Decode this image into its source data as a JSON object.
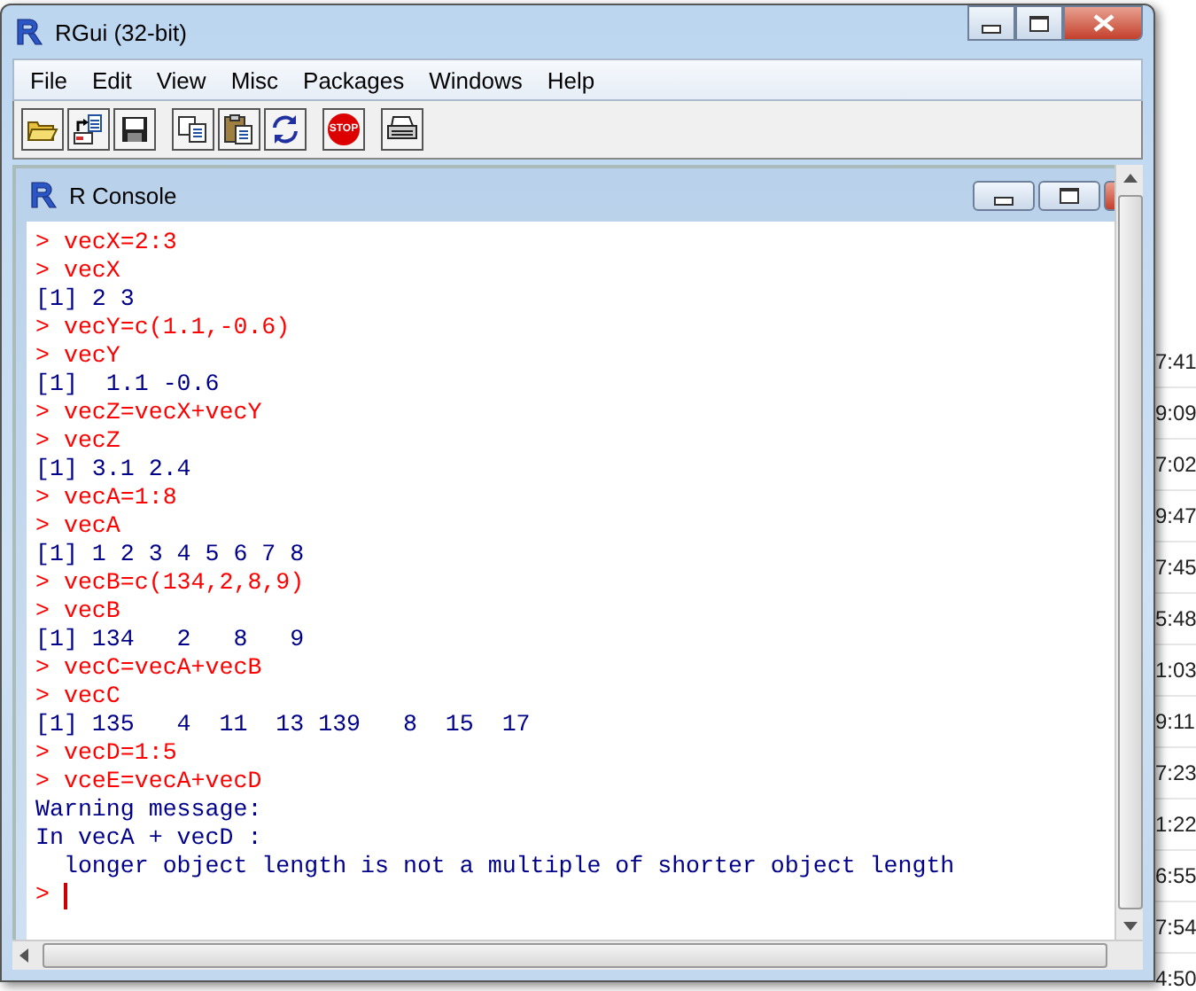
{
  "window": {
    "title": "RGui (32-bit)"
  },
  "menu": [
    "File",
    "Edit",
    "View",
    "Misc",
    "Packages",
    "Windows",
    "Help"
  ],
  "toolbar": [
    {
      "kind": "open"
    },
    {
      "kind": "load"
    },
    {
      "kind": "save"
    },
    {
      "kind": "sep"
    },
    {
      "kind": "copy"
    },
    {
      "kind": "paste"
    },
    {
      "kind": "refresh"
    },
    {
      "kind": "sep"
    },
    {
      "kind": "stop",
      "label": "STOP"
    },
    {
      "kind": "sep"
    },
    {
      "kind": "print"
    }
  ],
  "console": {
    "title": "R Console",
    "lines": [
      {
        "kind": "input",
        "prompt": ">",
        "text": "vecX=2:3"
      },
      {
        "kind": "input",
        "prompt": ">",
        "text": "vecX"
      },
      {
        "kind": "output",
        "text": "[1] 2 3"
      },
      {
        "kind": "input",
        "prompt": ">",
        "text": "vecY=c(1.1,-0.6)"
      },
      {
        "kind": "input",
        "prompt": ">",
        "text": "vecY"
      },
      {
        "kind": "output",
        "text": "[1]  1.1 -0.6"
      },
      {
        "kind": "input",
        "prompt": ">",
        "text": "vecZ=vecX+vecY"
      },
      {
        "kind": "input",
        "prompt": ">",
        "text": "vecZ"
      },
      {
        "kind": "output",
        "text": "[1] 3.1 2.4"
      },
      {
        "kind": "input",
        "prompt": ">",
        "text": "vecA=1:8"
      },
      {
        "kind": "input",
        "prompt": ">",
        "text": "vecA"
      },
      {
        "kind": "output",
        "text": "[1] 1 2 3 4 5 6 7 8"
      },
      {
        "kind": "input",
        "prompt": ">",
        "text": "vecB=c(134,2,8,9)"
      },
      {
        "kind": "input",
        "prompt": ">",
        "text": "vecB"
      },
      {
        "kind": "output",
        "text": "[1] 134   2   8   9"
      },
      {
        "kind": "input",
        "prompt": ">",
        "text": "vecC=vecA+vecB"
      },
      {
        "kind": "input",
        "prompt": ">",
        "text": "vecC"
      },
      {
        "kind": "output",
        "text": "[1] 135   4  11  13 139   8  15  17"
      },
      {
        "kind": "input",
        "prompt": ">",
        "text": "vecD=1:5"
      },
      {
        "kind": "input",
        "prompt": ">",
        "text": "vceE=vecA+vecD"
      },
      {
        "kind": "output",
        "text": "Warning message:"
      },
      {
        "kind": "output",
        "text": "In vecA + vecD :"
      },
      {
        "kind": "output",
        "text": "  longer object length is not a multiple of shorter object length"
      },
      {
        "kind": "cursor",
        "prompt": ">"
      }
    ]
  },
  "background_list": [
    "7:41",
    "9:09",
    "7:02",
    "9:47",
    "7:45",
    "5:48",
    "1:03",
    "9:11",
    "7:23",
    "1:22",
    "6:55",
    "7:54",
    "4:50"
  ]
}
